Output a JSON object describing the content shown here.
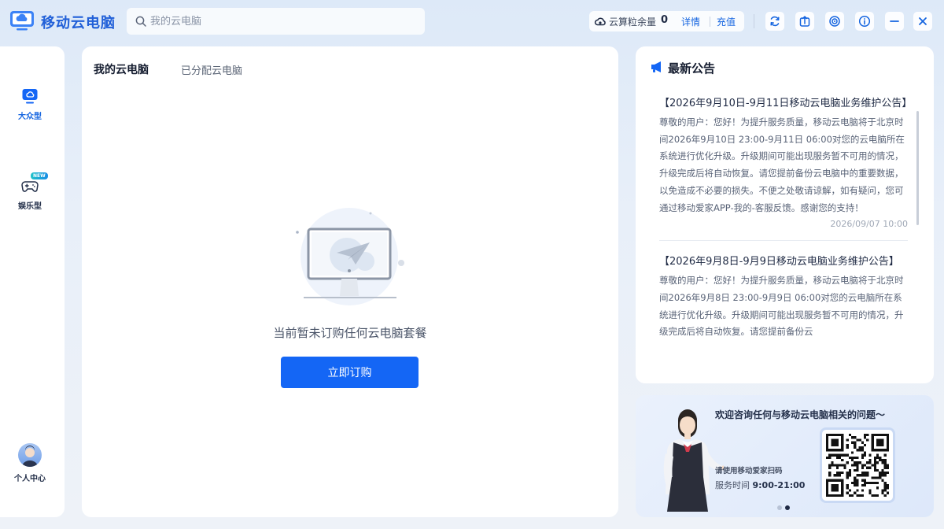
{
  "app": {
    "title": "移动云电脑"
  },
  "search": {
    "placeholder": "我的云电脑"
  },
  "balance": {
    "label": "云算粒余量",
    "value": "0",
    "detail_label": "详情",
    "recharge_label": "充值"
  },
  "nav": {
    "items": [
      {
        "label": "大众型",
        "icon": "monitor-cloud-icon",
        "active": true
      },
      {
        "label": "娱乐型",
        "icon": "gamepad-icon",
        "badge": "NEW",
        "active": false
      }
    ],
    "profile_label": "个人中心"
  },
  "main": {
    "tabs": [
      {
        "label": "我的云电脑",
        "active": true
      },
      {
        "label": "已分配云电脑",
        "active": false
      }
    ],
    "empty_text": "当前暂未订购任何云电脑套餐",
    "subscribe_label": "立即订购"
  },
  "announcements": {
    "title": "最新公告",
    "items": [
      {
        "title": "【2026年9月10日-9月11日移动云电脑业务维护公告】",
        "body": "尊敬的用户：您好！为提升服务质量，移动云电脑将于北京时间2026年9月10日 23:00-9月11日 06:00对您的云电脑所在系统进行优化升级。升级期间可能出现服务暂不可用的情况，升级完成后将自动恢复。请您提前备份云电脑中的重要数据，以免造成不必要的损失。不便之处敬请谅解，如有疑问，您可通过移动爱家APP-我的-客服反馈。感谢您的支持！",
        "date": "2026/09/07 10:00"
      },
      {
        "title": "【2026年9月8日-9月9日移动云电脑业务维护公告】",
        "body": "尊敬的用户：您好！为提升服务质量，移动云电脑将于北京时间2026年9月8日 23:00-9月9日 06:00对您的云电脑所在系统进行优化升级。升级期间可能出现服务暂不可用的情况，升级完成后将自动恢复。请您提前备份云",
        "date": ""
      }
    ]
  },
  "banner": {
    "title": "欢迎咨询任何与移动云电脑相关的问题～",
    "scan_text": "请使用移动爱家扫码",
    "hours_label": "服务时间",
    "hours_value": "9:00-21:00",
    "page_count": 2,
    "active_page": 2
  },
  "colors": {
    "brand": "#1466f5",
    "link": "#1565e0",
    "title": "#2160d8"
  },
  "icons": [
    "cloud-coin-icon",
    "refresh-icon",
    "share-icon",
    "settings-icon",
    "info-icon",
    "minimize-icon",
    "close-icon",
    "megaphone-icon"
  ]
}
